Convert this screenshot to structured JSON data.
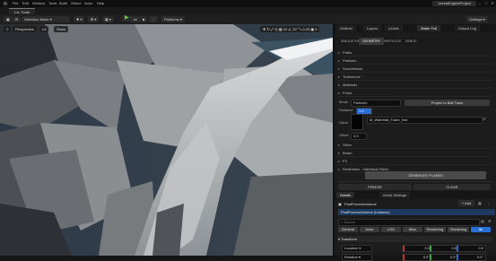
{
  "menu": {
    "logo": "U",
    "items": [
      "File",
      "Edit",
      "Window",
      "Tools",
      "Build",
      "Select",
      "Actor",
      "Help"
    ],
    "project": "UnrealEngineProject"
  },
  "tab": {
    "label": "LvL Tomb"
  },
  "toolbar": {
    "mode": "Selection Mode",
    "platforms": "Platforms",
    "settings": "Settings"
  },
  "viewport": {
    "perspective": "Perspective",
    "lit": "Lit",
    "show": "Show"
  },
  "outliner_tabs": [
    "Outliner",
    "Layers",
    "Levels",
    "Water Full",
    "Output Log"
  ],
  "subtabs": [
    "SIMULATION",
    "GEOMETRY",
    "PARTICLES",
    "DEBUG"
  ],
  "sections": [
    "Paths",
    "Particles",
    "Smoothness",
    "Turbulence",
    "Materials",
    "Force"
  ],
  "mode_row": {
    "label": "Mode",
    "value": "Particles",
    "button": "Project to Ball Track"
  },
  "distance": {
    "label": "Distance",
    "value": "1.0"
  },
  "material": {
    "label": "Value",
    "value": "M_Waterfall_Foam_Inst"
  },
  "offset": {
    "label": "Offset",
    "value": "0.0"
  },
  "sections2": [
    "Other",
    "Beam",
    "FX",
    "Restriction - Individual Paths"
  ],
  "generate": "GENERATE PLANES",
  "buttons": {
    "freeze": "FREEZE",
    "clear": "CLEAR"
  },
  "details_tabs": [
    "Details",
    "World Settings"
  ],
  "ppv": {
    "name": "PostProcessVolume",
    "instance": "PostProcessVolume (Instance)",
    "add": "+ Add",
    "search": "Search"
  },
  "filters": [
    "General",
    "Actor",
    "LOD",
    "Misc",
    "Rendering",
    "Streaming",
    "All"
  ],
  "transform": {
    "title": "Transform",
    "location": {
      "label": "Location",
      "x": "0.0",
      "y": "0.0",
      "z": "0.0"
    },
    "rotation": {
      "label": "Rotation",
      "x": "0.0°",
      "y": "0.0°",
      "z": "0.0°"
    }
  }
}
